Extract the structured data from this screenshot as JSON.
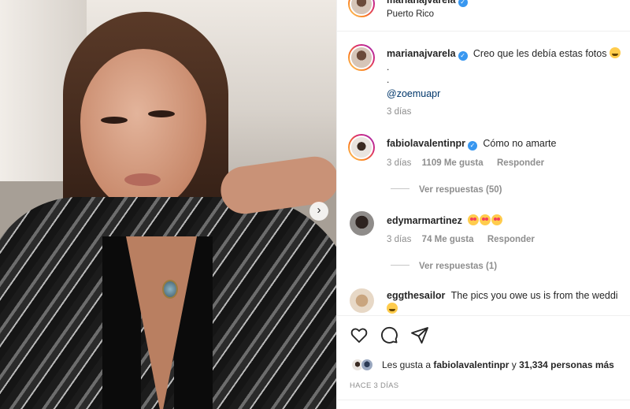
{
  "post": {
    "username": "marianajvarela",
    "location": "Puerto Rico",
    "caption_text": "Creo que les debía estas fotos",
    "caption_dot1": ".",
    "caption_dot2": ".",
    "mention": "@zoemuapr",
    "caption_time": "3 días"
  },
  "comments": [
    {
      "username": "fabiolavalentinpr",
      "text": "Cómo no amarte ",
      "hearts": "",
      "time": "3 días",
      "likes": "1109 Me gusta",
      "reply": "Responder",
      "view_replies": "Ver respuestas (50)"
    },
    {
      "username": "edymarmartinez",
      "time": "3 días",
      "likes": "74 Me gusta",
      "reply": "Responder",
      "view_replies": "Ver respuestas (1)"
    },
    {
      "username": "eggthesailor",
      "text": "The pics you owe us is from the weddi"
    }
  ],
  "likes_summary": {
    "prefix": "Les gusta a",
    "user": "fabiolavalentinpr",
    "middle": "y",
    "count": "31,334 personas más"
  },
  "posted_time": "HACE 3 DÍAS",
  "icons": [
    "heart-icon",
    "comment-icon",
    "share-icon",
    "chevron-right-icon",
    "verified-badge-icon"
  ],
  "colors": {
    "verified": "#3897f0",
    "link": "#00376b",
    "muted": "#8e8e8e"
  }
}
